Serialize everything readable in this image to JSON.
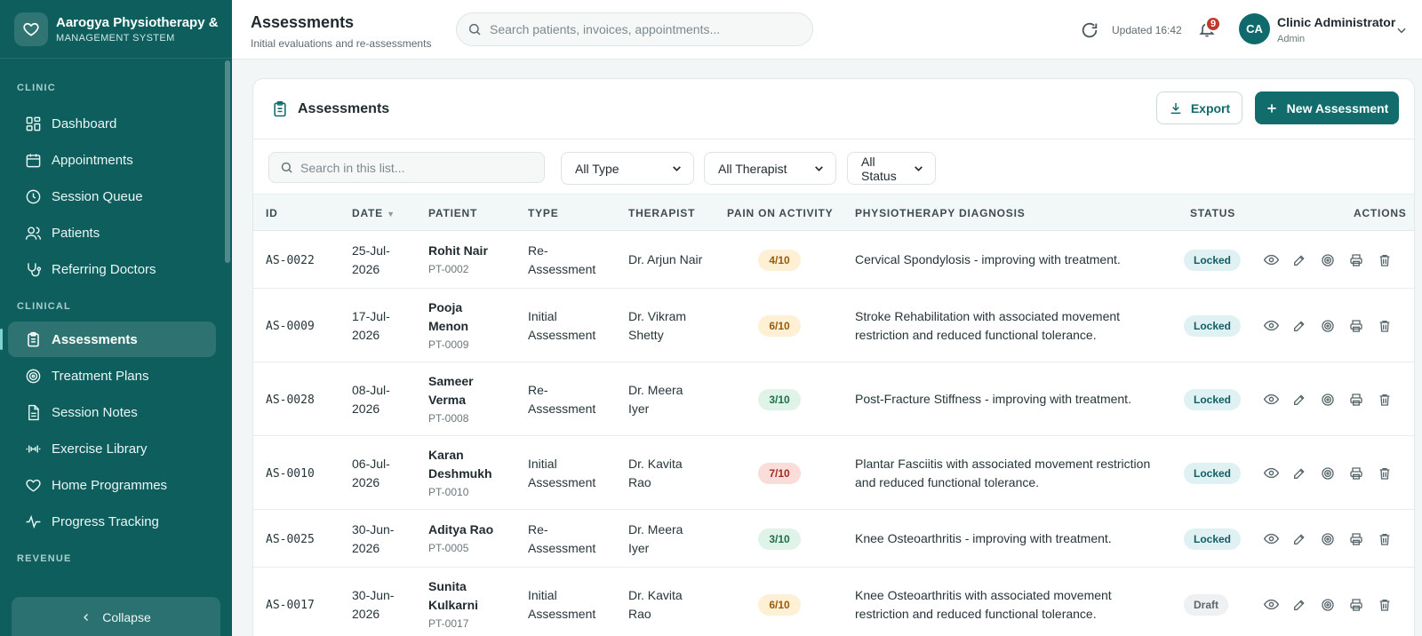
{
  "app": {
    "brand_name": "Aarogya Physiotherapy & I",
    "brand_sub": "MANAGEMENT SYSTEM"
  },
  "sidebar": {
    "sections": [
      {
        "title": "CLINIC",
        "items": [
          {
            "label": "Dashboard",
            "icon": "grid-icon"
          },
          {
            "label": "Appointments",
            "icon": "calendar-icon"
          },
          {
            "label": "Session Queue",
            "icon": "clock-icon"
          },
          {
            "label": "Patients",
            "icon": "users-icon"
          },
          {
            "label": "Referring Doctors",
            "icon": "stethoscope-icon"
          }
        ]
      },
      {
        "title": "CLINICAL",
        "items": [
          {
            "label": "Assessments",
            "icon": "clipboard-icon",
            "active": true
          },
          {
            "label": "Treatment Plans",
            "icon": "target-icon"
          },
          {
            "label": "Session Notes",
            "icon": "file-text-icon"
          },
          {
            "label": "Exercise Library",
            "icon": "dumbbell-icon"
          },
          {
            "label": "Home Programmes",
            "icon": "heart-icon"
          },
          {
            "label": "Progress Tracking",
            "icon": "activity-icon"
          }
        ]
      },
      {
        "title": "REVENUE",
        "items": []
      }
    ],
    "collapse_label": "Collapse"
  },
  "header": {
    "title": "Assessments",
    "subtitle": "Initial evaluations and re-assessments",
    "search_placeholder": "Search patients, invoices, appointments...",
    "updated": "Updated 16:42",
    "notification_count": "9",
    "user_initials": "CA",
    "user_name": "Clinic Administrator",
    "user_role": "Admin"
  },
  "card": {
    "title": "Assessments",
    "export_label": "Export",
    "new_label": "New Assessment",
    "list_search_placeholder": "Search in this list...",
    "filters": {
      "type": "All Type",
      "therapist": "All Therapist",
      "status": "All Status"
    }
  },
  "table": {
    "columns": {
      "id": "ID",
      "date": "DATE",
      "patient": "PATIENT",
      "type": "TYPE",
      "therapist": "THERAPIST",
      "pain": "PAIN ON ACTIVITY",
      "diagnosis": "PHYSIOTHERAPY DIAGNOSIS",
      "status": "STATUS",
      "actions": "ACTIONS"
    },
    "sort_indicator": "▼",
    "rows": [
      {
        "id": "AS-0022",
        "date_l1": "25-Jul-",
        "date_l2": "2026",
        "patient_l1": "Rohit Nair",
        "patient_l2": "",
        "patient_id": "PT-0002",
        "type_l1": "Re-",
        "type_l2": "Assessment",
        "therapist_l1": "Dr. Arjun Nair",
        "therapist_l2": "",
        "pain": "4/10",
        "pain_level": "mid",
        "diag_l1": "Cervical Spondylosis - improving with treatment.",
        "diag_l2": "",
        "status": "Locked",
        "status_kind": "locked"
      },
      {
        "id": "AS-0009",
        "date_l1": "17-Jul-",
        "date_l2": "2026",
        "patient_l1": "Pooja",
        "patient_l2": "Menon",
        "patient_id": "PT-0009",
        "type_l1": "Initial",
        "type_l2": "Assessment",
        "therapist_l1": "Dr. Vikram",
        "therapist_l2": "Shetty",
        "pain": "6/10",
        "pain_level": "mid",
        "diag_l1": "Stroke Rehabilitation with associated movement",
        "diag_l2": "restriction and reduced functional tolerance.",
        "status": "Locked",
        "status_kind": "locked"
      },
      {
        "id": "AS-0028",
        "date_l1": "08-Jul-",
        "date_l2": "2026",
        "patient_l1": "Sameer",
        "patient_l2": "Verma",
        "patient_id": "PT-0008",
        "type_l1": "Re-",
        "type_l2": "Assessment",
        "therapist_l1": "Dr. Meera",
        "therapist_l2": "Iyer",
        "pain": "3/10",
        "pain_level": "low",
        "diag_l1": "Post-Fracture Stiffness - improving with treatment.",
        "diag_l2": "",
        "status": "Locked",
        "status_kind": "locked"
      },
      {
        "id": "AS-0010",
        "date_l1": "06-Jul-",
        "date_l2": "2026",
        "patient_l1": "Karan",
        "patient_l2": "Deshmukh",
        "patient_id": "PT-0010",
        "type_l1": "Initial",
        "type_l2": "Assessment",
        "therapist_l1": "Dr. Kavita",
        "therapist_l2": "Rao",
        "pain": "7/10",
        "pain_level": "high",
        "diag_l1": "Plantar Fasciitis with associated movement restriction",
        "diag_l2": "and reduced functional tolerance.",
        "status": "Locked",
        "status_kind": "locked"
      },
      {
        "id": "AS-0025",
        "date_l1": "30-Jun-",
        "date_l2": "2026",
        "patient_l1": "Aditya Rao",
        "patient_l2": "",
        "patient_id": "PT-0005",
        "type_l1": "Re-",
        "type_l2": "Assessment",
        "therapist_l1": "Dr. Meera",
        "therapist_l2": "Iyer",
        "pain": "3/10",
        "pain_level": "low",
        "diag_l1": "Knee Osteoarthritis - improving with treatment.",
        "diag_l2": "",
        "status": "Locked",
        "status_kind": "locked"
      },
      {
        "id": "AS-0017",
        "date_l1": "30-Jun-",
        "date_l2": "2026",
        "patient_l1": "Sunita",
        "patient_l2": "Kulkarni",
        "patient_id": "PT-0017",
        "type_l1": "Initial",
        "type_l2": "Assessment",
        "therapist_l1": "Dr. Kavita",
        "therapist_l2": "Rao",
        "pain": "6/10",
        "pain_level": "mid",
        "diag_l1": "Knee Osteoarthritis with associated movement",
        "diag_l2": "restriction and reduced functional tolerance.",
        "status": "Draft",
        "status_kind": "draft"
      }
    ]
  },
  "colors": {
    "sidebar": "#0f5e5e",
    "primary": "#136c6c",
    "badge": "#c0392b"
  }
}
